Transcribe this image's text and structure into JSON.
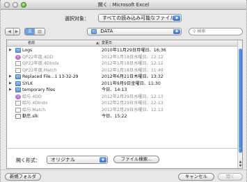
{
  "window": {
    "title": "開く : Microsoft Excel"
  },
  "filter": {
    "label": "選択対象：",
    "value": "すべての読み込み可能なファイル"
  },
  "location": {
    "folder": "DATA"
  },
  "search": {
    "placeholder": "検索"
  },
  "list": {
    "headers": {
      "name": "名前",
      "date": "変更日"
    },
    "rows": [
      {
        "name": "Logs",
        "date": "2010年11月29日月曜日、16:36",
        "kind": "folder",
        "expandable": true,
        "dim": false
      },
      {
        "name": "QP22年度.4DD",
        "date": "2012年1月18日水曜日、12:12",
        "kind": "db",
        "expandable": false,
        "dim": true
      },
      {
        "name": "QP22年度.4DIndx",
        "date": "2012年1月18日水曜日、12:12",
        "kind": "doc",
        "expandable": false,
        "dim": true
      },
      {
        "name": "QP22年度.Match",
        "date": "2012年1月18日水曜日、11:49",
        "kind": "doc",
        "expandable": false,
        "dim": true
      },
      {
        "name": "Replaced File...1 13-32-29",
        "date": "2012年6月21日木曜日、13:32",
        "kind": "folder",
        "expandable": true,
        "dim": false
      },
      {
        "name": "SYLK",
        "date": "2011年9月9日金曜日、11:30",
        "kind": "folder",
        "expandable": true,
        "dim": false
      },
      {
        "name": "temporary files",
        "date": "今日、14:13",
        "kind": "folder",
        "expandable": true,
        "dim": false
      },
      {
        "name": "給与.4DD",
        "date": "2012年2月29日水曜日、12:13",
        "kind": "db",
        "expandable": false,
        "dim": true
      },
      {
        "name": "給与.4DIndx",
        "date": "2012年2月29日水曜日、12:13",
        "kind": "doc",
        "expandable": false,
        "dim": true
      },
      {
        "name": "給与.Match",
        "date": "2012年2月29日水曜日、12:13",
        "kind": "doc",
        "expandable": false,
        "dim": true
      },
      {
        "name": "勤怠.slk",
        "date": "今日、15:22",
        "kind": "xls",
        "expandable": false,
        "dim": false
      }
    ]
  },
  "format": {
    "label": "開く形式：",
    "value": "オリジナル",
    "search_button": "ファイル検索..."
  },
  "buttons": {
    "new_folder": "新規フォルダ",
    "cancel": "キャンセル",
    "open": "開く"
  },
  "colors": {
    "accent": "#3a7ad9",
    "folder": "#5d98d6"
  }
}
